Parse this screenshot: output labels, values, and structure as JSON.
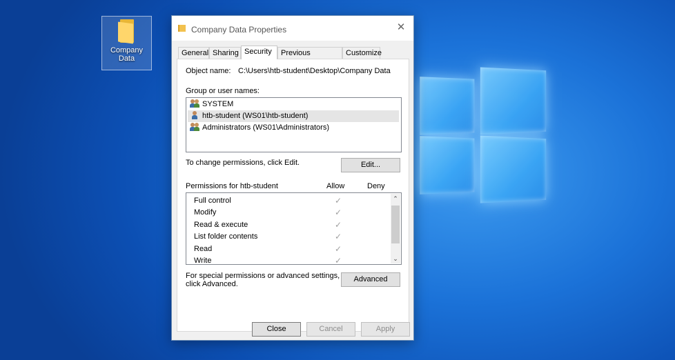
{
  "desktop": {
    "folder_icon": "folder-icon",
    "folder_label_line1": "Company",
    "folder_label_line2": "Data"
  },
  "dialog": {
    "title": "Company Data Properties",
    "close_glyph": "✕",
    "tabs": [
      "General",
      "Sharing",
      "Security",
      "Previous Versions",
      "Customize"
    ],
    "active_tab": "Security",
    "object_name_label": "Object name:",
    "object_name_value": "C:\\Users\\htb-student\\Desktop\\Company Data",
    "group_label": "Group or user names:",
    "users": [
      {
        "name": "SYSTEM",
        "icon": "group-icon",
        "selected": false
      },
      {
        "name": "htb-student (WS01\\htb-student)",
        "icon": "user-icon",
        "selected": true
      },
      {
        "name": "Administrators (WS01\\Administrators)",
        "icon": "group-icon",
        "selected": false
      }
    ],
    "change_text": "To change permissions, click Edit.",
    "edit_button": "Edit...",
    "perm_header": "Permissions for htb-student",
    "allow_header": "Allow",
    "deny_header": "Deny",
    "permissions": [
      {
        "name": "Full control",
        "allow": true,
        "deny": false
      },
      {
        "name": "Modify",
        "allow": true,
        "deny": false
      },
      {
        "name": "Read & execute",
        "allow": true,
        "deny": false
      },
      {
        "name": "List folder contents",
        "allow": true,
        "deny": false
      },
      {
        "name": "Read",
        "allow": true,
        "deny": false
      },
      {
        "name": "Write",
        "allow": true,
        "deny": false
      }
    ],
    "check_glyph": "✓",
    "advanced_text_line1": "For special permissions or advanced settings,",
    "advanced_text_line2": "click Advanced.",
    "advanced_button": "Advanced",
    "close_button": "Close",
    "cancel_button": "Cancel",
    "apply_button": "Apply"
  }
}
